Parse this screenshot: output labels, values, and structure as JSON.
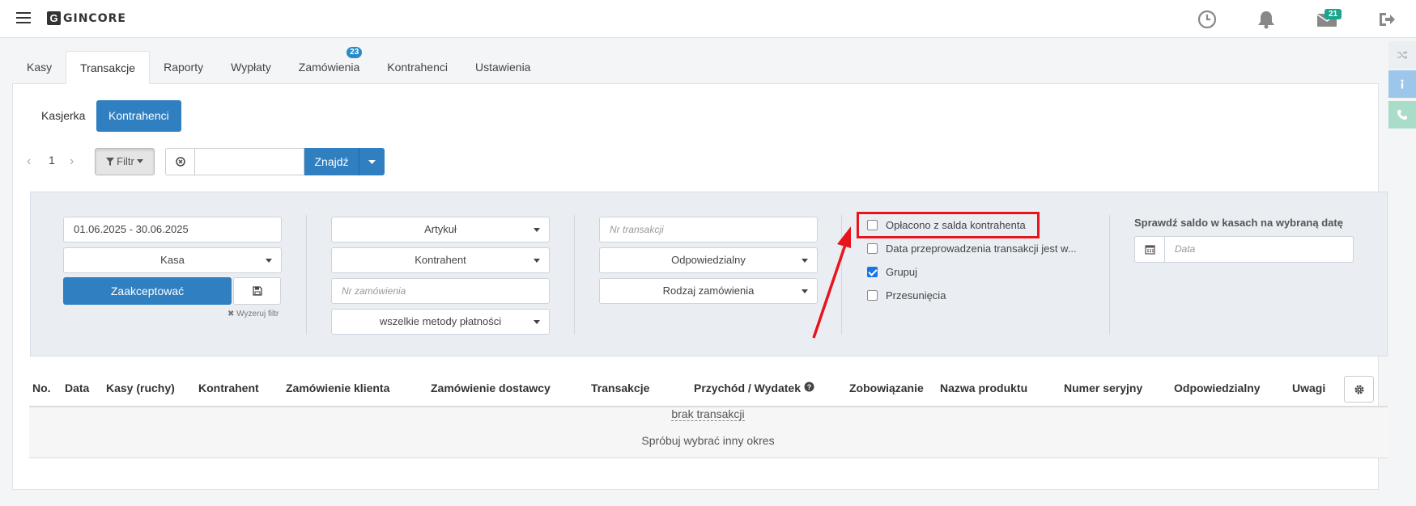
{
  "header": {
    "logo_letter": "G",
    "logo_text": "GINCORE",
    "messages_badge": "21",
    "icons": [
      "hamburger-icon",
      "clock-icon",
      "bell-icon",
      "envelope-icon",
      "logout-icon"
    ]
  },
  "tabs": [
    {
      "label": "Kasy"
    },
    {
      "label": "Transakcje",
      "active": true
    },
    {
      "label": "Raporty"
    },
    {
      "label": "Wypłaty"
    },
    {
      "label": "Zamówienia",
      "badge": "23"
    },
    {
      "label": "Kontrahenci"
    },
    {
      "label": "Ustawienia"
    }
  ],
  "subtabs": [
    {
      "label": "Kasjerka"
    },
    {
      "label": "Kontrahenci",
      "active": true
    }
  ],
  "pager": {
    "page": "1"
  },
  "toolbar": {
    "filter_label": "Filtr",
    "search_value": "",
    "search_button": "Znajdź"
  },
  "filters": {
    "date_range": "01.06.2025 - 30.06.2025",
    "kasa": "Kasa",
    "accept": "Zaakceptować",
    "clear_filter": "Wyzeruj filtr",
    "artykul": "Artykuł",
    "kontrahent": "Kontrahent",
    "nr_zamowienia": "Nr zamówienia",
    "payment_methods": "wszelkie metody płatności",
    "nr_transakcji": "Nr transakcji",
    "odpowiedzialny": "Odpowiedzialny",
    "rodzaj_zamowienia": "Rodzaj zamówienia",
    "checkboxes": [
      {
        "label": "Opłacono z salda kontrahenta",
        "checked": false
      },
      {
        "label": "Data przeprowadzenia transakcji jest w...",
        "checked": false
      },
      {
        "label": "Grupuj",
        "checked": true
      },
      {
        "label": "Przesunięcia",
        "checked": false
      }
    ],
    "saldo_title": "Sprawdź saldo w kasach na wybraną datę",
    "date_placeholder": "Data"
  },
  "table": {
    "headers": [
      "No.",
      "Data",
      "Kasy (ruchy)",
      "Kontrahent",
      "Zamówienie klienta",
      "Zamówienie dostawcy",
      "Transakcje",
      "Przychód / Wydatek",
      "Zobowiązanie",
      "Nazwa produktu",
      "Numer seryjny",
      "Odpowiedzialny",
      "Uwagi"
    ],
    "empty_title": "brak transakcji",
    "empty_hint": "Spróbuj wybrać inny okres"
  },
  "colors": {
    "primary": "#2f7fc1",
    "highlight": "#e8141b",
    "badge_green": "#1aa58e",
    "filter_bg": "#eaeef3"
  }
}
